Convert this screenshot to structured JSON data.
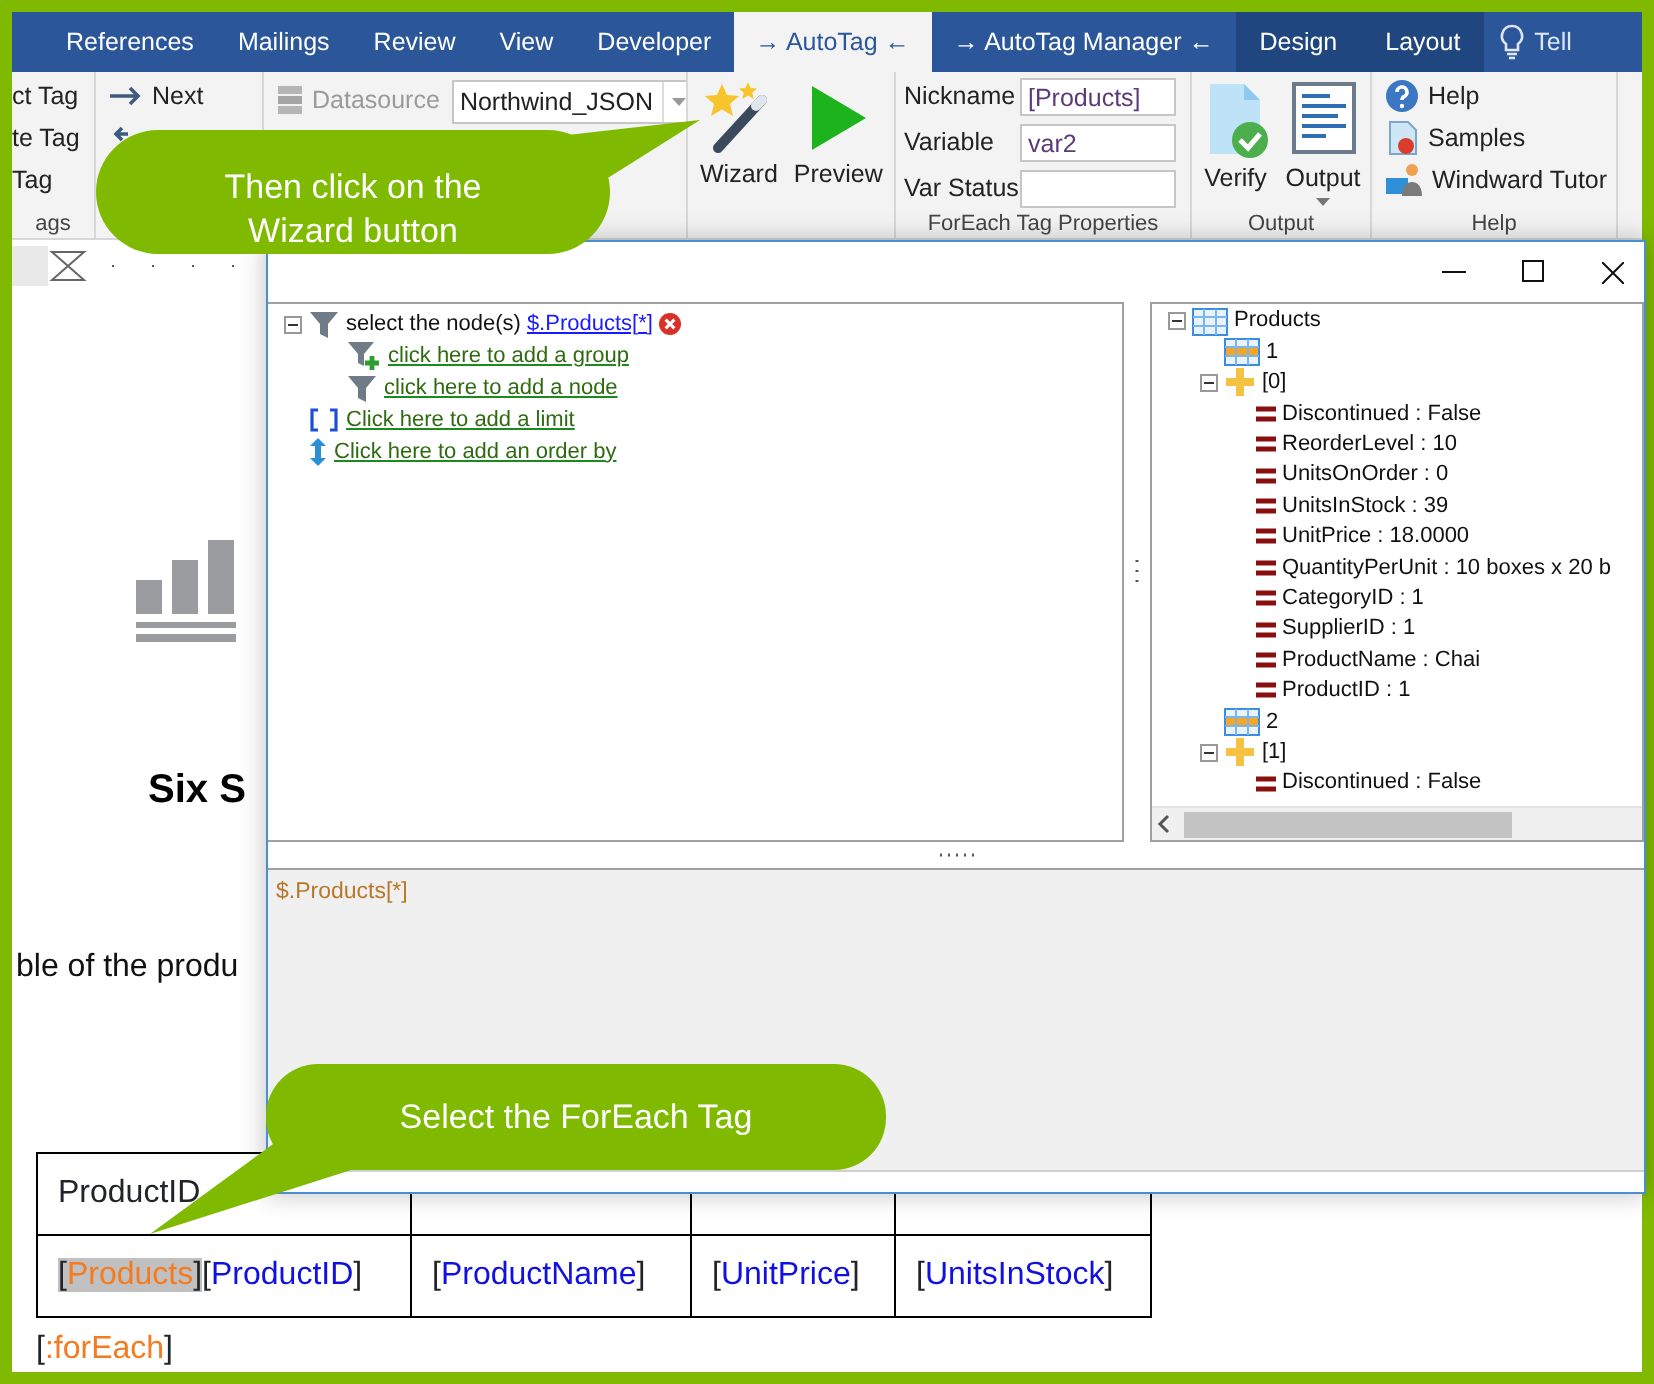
{
  "ribbon_tabs": [
    {
      "label": "References",
      "selected": false,
      "kind": "standard"
    },
    {
      "label": "Mailings",
      "selected": false,
      "kind": "standard"
    },
    {
      "label": "Review",
      "selected": false,
      "kind": "standard"
    },
    {
      "label": "View",
      "selected": false,
      "kind": "standard"
    },
    {
      "label": "Developer",
      "selected": false,
      "kind": "standard"
    },
    {
      "label": "→ AutoTag ←",
      "selected": true,
      "kind": "standard"
    },
    {
      "label": "→ AutoTag Manager ←",
      "selected": false,
      "kind": "standard"
    },
    {
      "label": "Design",
      "selected": false,
      "kind": "contextual"
    },
    {
      "label": "Layout",
      "selected": false,
      "kind": "contextual"
    }
  ],
  "tell_me": "Tell",
  "ribbon": {
    "tag_group": {
      "items": [
        "ct Tag",
        "te Tag",
        "Tag"
      ],
      "label": "ags"
    },
    "navigation": {
      "next": "Next"
    },
    "datasource": {
      "label": "Datasource",
      "disabled": true,
      "value": "Northwind_JSON"
    },
    "actions": [
      {
        "label": "Wizard",
        "kind": "wizard"
      },
      {
        "label": "Preview",
        "kind": "preview"
      }
    ],
    "tag_properties": {
      "fields": [
        {
          "label": "Nickname",
          "value": "[Products]"
        },
        {
          "label": "Variable",
          "value": "var2"
        },
        {
          "label": "Var Status"
        }
      ],
      "label": "ForEach Tag Properties"
    },
    "output": {
      "buttons": [
        {
          "label": "Verify",
          "kind": "verify"
        },
        {
          "label": "Output",
          "kind": "output"
        }
      ],
      "label": "Output"
    },
    "help": {
      "items": [
        {
          "label": "Help",
          "kind": "help"
        },
        {
          "label": "Samples",
          "kind": "samples"
        },
        {
          "label": "Windward Tutor",
          "kind": "tutor"
        }
      ],
      "label": "Help"
    }
  },
  "document": {
    "heading": "Six S",
    "paragraph": "ble of the produ",
    "table": {
      "header": [
        "ProductID"
      ],
      "rows": [
        [
          {
            "tags": [
              {
                "open": "[",
                "name": "Products",
                "close": "]",
                "kind": "foreach",
                "selected": true
              },
              {
                "open": "[",
                "name": "ProductID",
                "close": "]",
                "kind": "field",
                "selected": false
              }
            ]
          },
          {
            "tags": [
              {
                "open": "[",
                "name": "ProductName",
                "close": "]",
                "kind": "field",
                "selected": false
              }
            ]
          },
          {
            "tags": [
              {
                "open": "[",
                "name": "UnitPrice",
                "close": "]",
                "kind": "field",
                "selected": false
              }
            ]
          },
          {
            "tags": [
              {
                "open": "[",
                "name": "UnitsInStock",
                "close": "]",
                "kind": "field",
                "selected": false
              }
            ]
          }
        ]
      ]
    },
    "footer": {
      "tags": [
        {
          "open": "[",
          "name": ":forEach",
          "close": "]",
          "kind": "foreach",
          "selected": false
        }
      ]
    }
  },
  "dialog": {
    "query_tree": [
      {
        "kind": "filter",
        "text": "select the node(s)",
        "link": "$.Products[*]",
        "expanded": true,
        "children": [
          {
            "kind": "group",
            "link": "click here to add a group"
          },
          {
            "kind": "node",
            "link": "click here to add a node"
          }
        ]
      },
      {
        "kind": "limit",
        "link": "Click here to add a limit"
      },
      {
        "kind": "order",
        "link": "Click here to add an order by"
      }
    ],
    "data_tree": [
      {
        "kind": "array",
        "label": "Products",
        "expanded": true,
        "children": [
          {
            "kind": "row",
            "label": "1"
          },
          {
            "kind": "object",
            "label": "[0]",
            "expanded": true,
            "children": [
              {
                "kind": "field",
                "label": "Discontinued : False"
              },
              {
                "kind": "field",
                "label": "ReorderLevel : 10"
              },
              {
                "kind": "field",
                "label": "UnitsOnOrder : 0"
              },
              {
                "kind": "field",
                "label": "UnitsInStock : 39"
              },
              {
                "kind": "field",
                "label": "UnitPrice : 18.0000"
              },
              {
                "kind": "field",
                "label": "QuantityPerUnit : 10 boxes x 20 b"
              },
              {
                "kind": "field",
                "label": "CategoryID : 1"
              },
              {
                "kind": "field",
                "label": "SupplierID : 1"
              },
              {
                "kind": "field",
                "label": "ProductName : Chai"
              },
              {
                "kind": "field",
                "label": "ProductID : 1"
              }
            ]
          },
          {
            "kind": "row",
            "label": "2"
          },
          {
            "kind": "object",
            "label": "[1]",
            "expanded": true,
            "children": [
              {
                "kind": "field",
                "label": "Discontinued : False"
              }
            ]
          }
        ]
      }
    ],
    "expression": "$.Products[*]"
  },
  "callouts": [
    {
      "text": "Then click on the Wizard button"
    },
    {
      "text": "Select the ForEach Tag"
    }
  ]
}
